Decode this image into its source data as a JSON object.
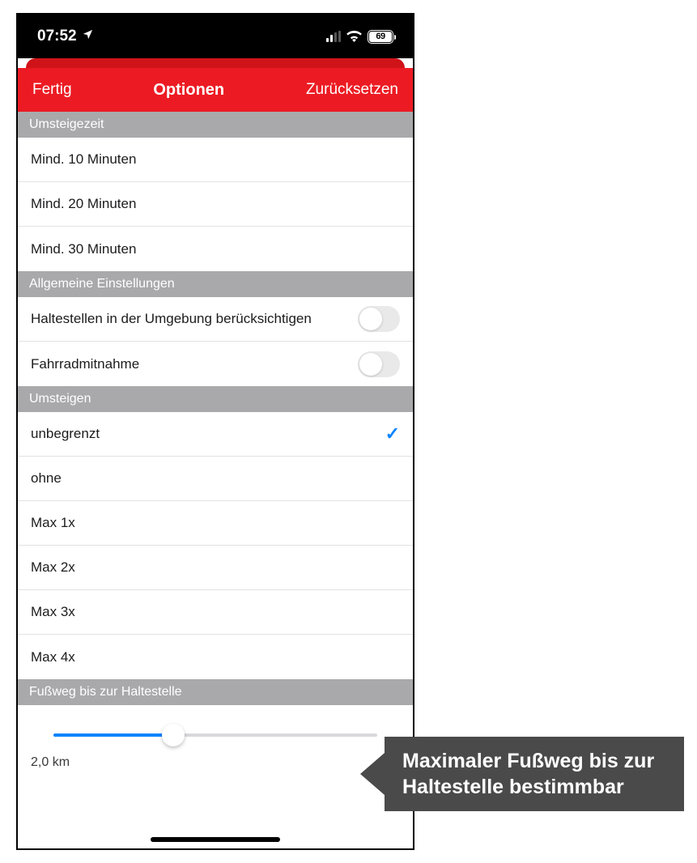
{
  "statusbar": {
    "time": "07:52",
    "battery": "69"
  },
  "navbar": {
    "done": "Fertig",
    "title": "Optionen",
    "reset": "Zurücksetzen"
  },
  "sections": {
    "transfer_time": {
      "header": "Umsteigezeit",
      "items": [
        "Mind. 10 Minuten",
        "Mind. 20 Minuten",
        "Mind. 30 Minuten"
      ]
    },
    "general": {
      "header": "Allgemeine Einstellungen",
      "nearby_stops": {
        "label": "Haltestellen in der Umgebung berücksichtigen",
        "value": false
      },
      "bike": {
        "label": "Fahrradmitnahme",
        "value": false
      }
    },
    "transfers": {
      "header": "Umsteigen",
      "items": [
        {
          "label": "unbegrenzt",
          "selected": true
        },
        {
          "label": "ohne",
          "selected": false
        },
        {
          "label": "Max 1x",
          "selected": false
        },
        {
          "label": "Max 2x",
          "selected": false
        },
        {
          "label": "Max 3x",
          "selected": false
        },
        {
          "label": "Max 4x",
          "selected": false
        }
      ]
    },
    "footpath": {
      "header": "Fußweg bis zur Haltestelle",
      "value_label": "2,0 km",
      "slider_percent": 37
    }
  },
  "callout": {
    "text": "Maximaler Fußweg bis zur Haltestelle bestimmbar"
  }
}
